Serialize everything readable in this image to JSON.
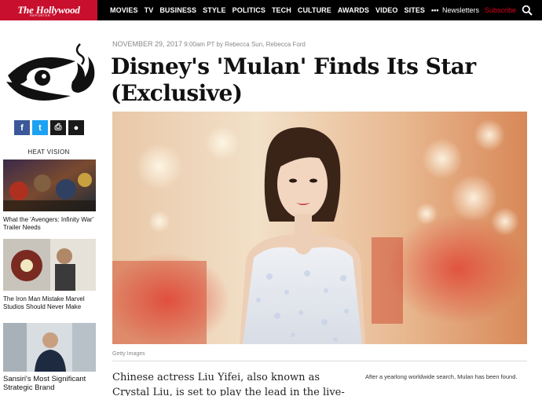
{
  "brand": {
    "name": "The Hollywood",
    "sub": "REPORTER"
  },
  "nav": {
    "items": [
      "MOVIES",
      "TV",
      "BUSINESS",
      "STYLE",
      "POLITICS",
      "TECH",
      "CULTURE",
      "AWARDS",
      "VIDEO",
      "SITES"
    ],
    "more": "•••",
    "newsletters": "Newsletters",
    "subscribe": "Subscribe"
  },
  "share": {
    "facebook": "f",
    "twitter": "t",
    "print": "⎙",
    "comment": "●"
  },
  "rail": {
    "heading": "HEAT VISION",
    "stories": [
      {
        "caption": "What the 'Avengers: Infinity War' Trailer Needs"
      },
      {
        "caption": "The Iron Man Mistake Marvel Studios Should Never Make"
      },
      {
        "caption": "Sansiri's Most Significant Strategic Brand"
      }
    ]
  },
  "article": {
    "date": "NOVEMBER 29, 2017",
    "time_byline": "9:00am PT by Rebecca Sun, Rebecca Ford",
    "headline": "Disney's 'Mulan' Finds Its Star (Exclusive)",
    "photo_credit": "Getty Images",
    "lede": "Chinese actress Liu Yifei, also known as Crystal Liu, is set to play the lead in the live-action",
    "side_note": "After a yearlong worldwide search, Mulan has been found."
  },
  "colors": {
    "brand_red": "#c8102e",
    "nav_bg": "#000000",
    "subscribe": "#e0001b"
  }
}
